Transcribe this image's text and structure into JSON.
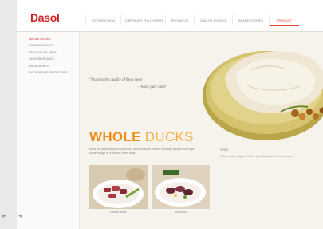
{
  "brand": {
    "logo_text": "Dasol"
  },
  "nav": {
    "items": [
      {
        "label": "INTRODUCTION"
      },
      {
        "label": "CORPORATE PHILOSOPHY"
      },
      {
        "label": "PROGRESS"
      },
      {
        "label": "QUALITY SERVICE"
      },
      {
        "label": "BRAND STORIES"
      },
      {
        "label": "PRODUCT"
      }
    ],
    "active_index": 5
  },
  "sidebar": {
    "items": [
      {
        "label": "WHOLE DUCKS"
      },
      {
        "label": "SMOKED DUCKS"
      },
      {
        "label": "FRESH DUCK MEAT"
      },
      {
        "label": "SEASONED DUCK"
      },
      {
        "label": "DUCK DISHES"
      },
      {
        "label": "DUCK PROCESSED FOODS"
      }
    ],
    "active_index": 0
  },
  "main": {
    "quote_line1": "\"Trustworthy quality of fresh meat",
    "quote_line2": "- choice pure meat\"",
    "title_bold": "WHOLE",
    "title_light": " DUCKS",
    "description": "All of the duck meat produced by Dasol receives perfect hind-rate ducks to the eye. It's an image of a healthy fresh duck.",
    "info_title": "SPEC",
    "info_rows": "Whole duck weight and size specifications are shown here.",
    "photos": [
      {
        "caption": "Bubble steak"
      },
      {
        "caption": "Black rice"
      }
    ]
  },
  "colors": {
    "brand_red": "#d0232a",
    "accent_orange": "#f08e1c",
    "background": "#f6f2ec"
  },
  "icons": {
    "prev": "chevron-left-icon",
    "next": "chevron-right-icon"
  }
}
